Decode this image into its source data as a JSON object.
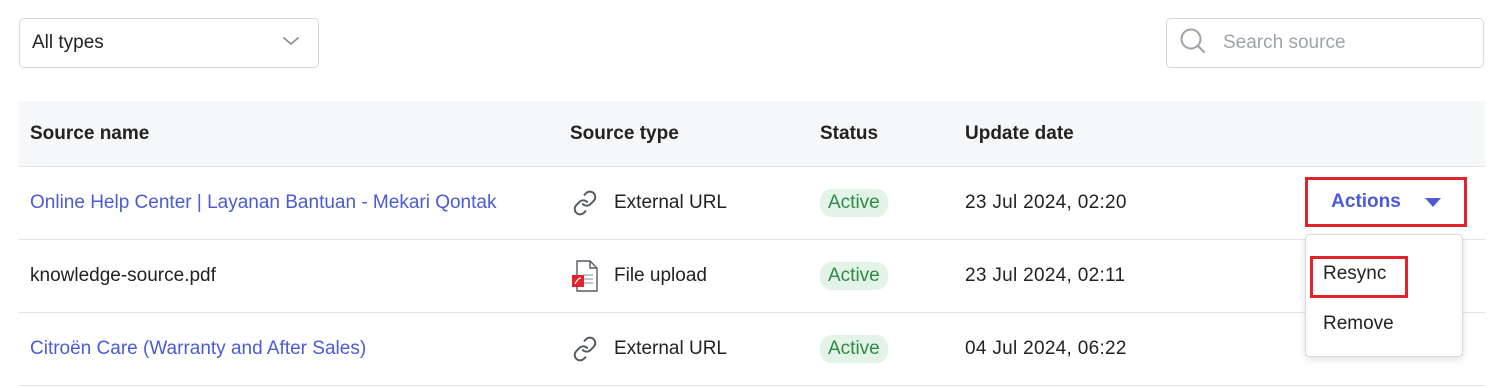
{
  "filter": {
    "selected": "All types",
    "icon": "chevron-down-icon"
  },
  "search": {
    "placeholder": "Search source",
    "value": "",
    "icon": "search-icon"
  },
  "table": {
    "headers": [
      "Source name",
      "Source type",
      "Status",
      "Update date"
    ],
    "rows": [
      {
        "name": "Online Help Center | Layanan Bantuan - Mekari Qontak",
        "is_link": true,
        "type": "External URL",
        "type_icon": "link-icon",
        "status": "Active",
        "date": "23 Jul 2024, 02:20"
      },
      {
        "name": "knowledge-source.pdf",
        "is_link": false,
        "type": "File upload",
        "type_icon": "pdf-file-icon",
        "status": "Active",
        "date": "23 Jul 2024, 02:11"
      },
      {
        "name": "Citroën Care (Warranty and After Sales)",
        "is_link": true,
        "type": "External URL",
        "type_icon": "link-icon",
        "status": "Active",
        "date": "04 Jul 2024, 06:22"
      }
    ]
  },
  "actions": {
    "label": "Actions",
    "menu": [
      "Resync",
      "Remove"
    ]
  },
  "colors": {
    "link": "#4b5bd6",
    "status_bg": "#e3f3e7",
    "status_text": "#2e8a47",
    "highlight": "#e3232b"
  }
}
